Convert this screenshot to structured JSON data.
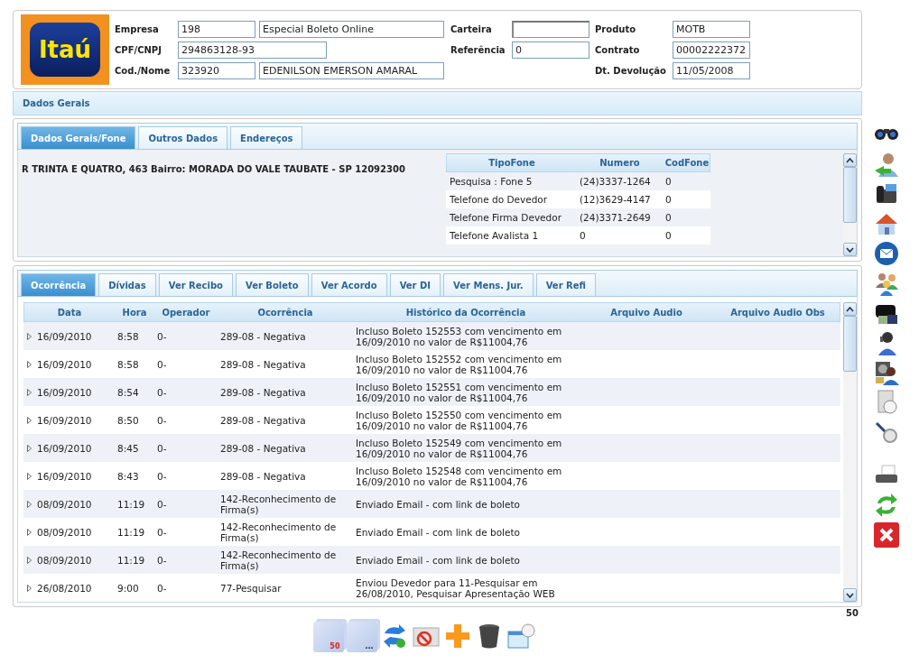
{
  "header": {
    "logo": "Itaú",
    "rows": [
      {
        "cells": [
          {
            "label": "Empresa",
            "fields": [
              {
                "value": "198"
              },
              {
                "value": "Especial Boleto Online"
              }
            ]
          },
          {
            "label": "Carteira"
          },
          {
            "label": "Produto",
            "fields": [
              {
                "value": "MOTB"
              }
            ]
          }
        ]
      },
      {
        "cells": [
          {
            "label": "CPF/CNPJ",
            "fields": [
              {
                "value": "294863128-93"
              }
            ]
          },
          {
            "label": "Referência",
            "fields": [
              {
                "value": "0"
              }
            ]
          },
          {
            "label": "Contrato",
            "fields": [
              {
                "value": "00002222372"
              }
            ]
          }
        ]
      },
      {
        "cells": [
          {
            "label": "Cod./Nome",
            "fields": [
              {
                "value": "323920"
              },
              {
                "value": "EDENILSON EMERSON AMARAL"
              }
            ]
          },
          null,
          {
            "label": "Dt. Devolução",
            "fields": [
              {
                "value": "11/05/2008"
              }
            ]
          }
        ]
      }
    ]
  },
  "section_bar": "Dados Gerais",
  "general": {
    "tabs": [
      {
        "label": "Dados Gerais/Fone",
        "selected": true
      },
      {
        "label": "Outros Dados",
        "selected": false
      },
      {
        "label": "Endereços",
        "selected": false
      }
    ],
    "address": "R TRINTA E QUATRO, 463 Bairro: MORADA DO VALE TAUBATE - SP 12092300",
    "phones": {
      "columns": [
        "TipoFone",
        "Numero",
        "CodFone"
      ],
      "rows": [
        [
          "Pesquisa : Fone 5",
          "(24)3337-1264",
          "0"
        ],
        [
          "Telefone do Devedor",
          "(12)3629-4147",
          "0"
        ],
        [
          "Telefone Firma Devedor",
          "(24)3371-2649",
          "0"
        ],
        [
          "Telefone Avalista 1",
          "0",
          "0"
        ]
      ]
    }
  },
  "occurrences": {
    "tabs": [
      {
        "label": "Ocorrência",
        "selected": true
      },
      {
        "label": "Dívidas",
        "selected": false
      },
      {
        "label": "Ver Recibo",
        "selected": false
      },
      {
        "label": "Ver Boleto",
        "selected": false
      },
      {
        "label": "Ver Acordo",
        "selected": false
      },
      {
        "label": "Ver DI",
        "selected": false
      },
      {
        "label": "Ver Mens. Jur.",
        "selected": false
      },
      {
        "label": "Ver Refi",
        "selected": false
      }
    ],
    "columns": [
      "Data",
      "Hora",
      "Operador",
      "Ocorrência",
      "Histórico da Ocorrência",
      "Arquivo Audio",
      "Arquivo Audio Obs"
    ],
    "rows": [
      [
        "16/09/2010",
        "8:58",
        "0-",
        "289-08 - Negativa",
        "Incluso Boleto 152553 com vencimento em 16/09/2010 no valor de R$11004,76"
      ],
      [
        "16/09/2010",
        "8:58",
        "0-",
        "289-08 - Negativa",
        "Incluso Boleto 152552 com vencimento em 16/09/2010 no valor de R$11004,76"
      ],
      [
        "16/09/2010",
        "8:54",
        "0-",
        "289-08 - Negativa",
        "Incluso Boleto 152551 com vencimento em 16/09/2010 no valor de R$11004,76"
      ],
      [
        "16/09/2010",
        "8:50",
        "0-",
        "289-08 - Negativa",
        "Incluso Boleto 152550 com vencimento em 16/09/2010 no valor de R$11004,76"
      ],
      [
        "16/09/2010",
        "8:45",
        "0-",
        "289-08 - Negativa",
        "Incluso Boleto 152549 com vencimento em 16/09/2010 no valor de R$11004,76"
      ],
      [
        "16/09/2010",
        "8:43",
        "0-",
        "289-08 - Negativa",
        "Incluso Boleto 152548 com vencimento em 16/09/2010 no valor de R$11004,76"
      ],
      [
        "08/09/2010",
        "11:19",
        "0-",
        "142-Reconhecimento de Firma(s)",
        "Enviado Email - com link de boleto"
      ],
      [
        "08/09/2010",
        "11:19",
        "0-",
        "142-Reconhecimento de Firma(s)",
        "Enviado Email - com link de boleto"
      ],
      [
        "08/09/2010",
        "11:19",
        "0-",
        "142-Reconhecimento de Firma(s)",
        "Enviado Email - com link de boleto"
      ],
      [
        "26/08/2010",
        "9:00",
        "0-",
        "77-Pesquisar",
        "Enviou Devedor para 11-Pesquisar em 26/08/2010, Pesquisar Apresentação WEB"
      ]
    ],
    "count": "50"
  },
  "bottom_toolbar": {
    "page_size": "50",
    "more": "..."
  }
}
